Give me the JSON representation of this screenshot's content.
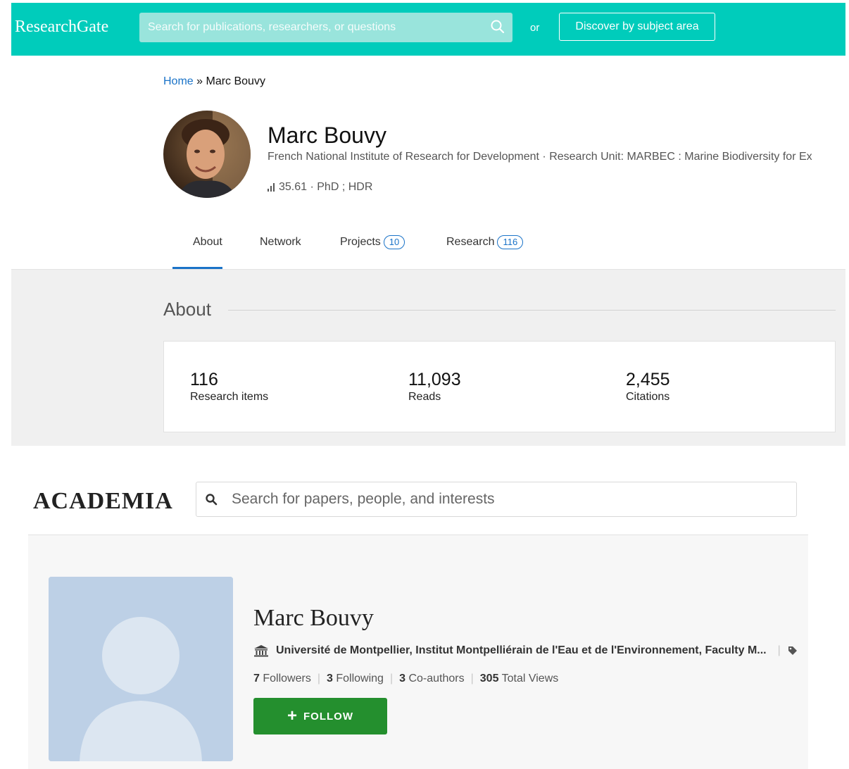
{
  "researchgate": {
    "logo": "ResearchGate",
    "search_placeholder": "Search for publications, researchers, or questions",
    "or_text": "or",
    "discover_label": "Discover by subject area",
    "breadcrumb": {
      "home": "Home",
      "separator": " » ",
      "current": "Marc Bouvy"
    },
    "profile": {
      "name": "Marc Bouvy",
      "institution": "French National Institute of Research for Development · Research Unit: MARBEC : Marine Biodiversity for Ex",
      "score": "35.61 · PhD ; HDR"
    },
    "tabs": [
      {
        "label": "About",
        "count": ""
      },
      {
        "label": "Network",
        "count": ""
      },
      {
        "label": "Projects",
        "count": "10"
      },
      {
        "label": "Research",
        "count": "116"
      }
    ],
    "about_title": "About",
    "stats": [
      {
        "value": "116",
        "label": "Research items"
      },
      {
        "value": "11,093",
        "label": "Reads"
      },
      {
        "value": "2,455",
        "label": "Citations"
      }
    ],
    "colors": {
      "brand": "#00ccbb",
      "link": "#1a73c8"
    }
  },
  "academia": {
    "logo": "ACADEMIA",
    "search_placeholder": "Search for papers, people, and interests",
    "profile": {
      "name": "Marc Bouvy",
      "affiliation": "Université de Montpellier, Institut Montpelliérain de l'Eau et de l'Environnement, Faculty M...",
      "followers_count": "7",
      "followers_label": "Followers",
      "following_count": "3",
      "following_label": "Following",
      "coauthors_count": "3",
      "coauthors_label": "Co-authors",
      "views_count": "305",
      "views_label": "Total Views"
    },
    "follow_label": "FOLLOW",
    "colors": {
      "follow": "#248f2e",
      "avatar_bg": "#bdd0e6"
    }
  }
}
